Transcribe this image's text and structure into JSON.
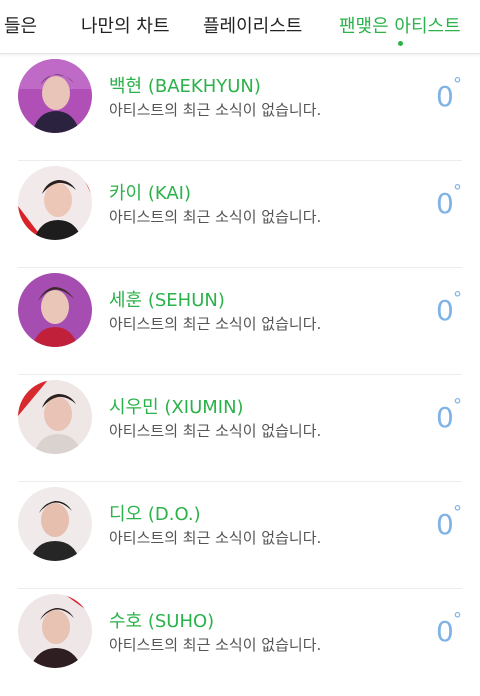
{
  "tabs": [
    {
      "label": "들은"
    },
    {
      "label": "나만의 차트"
    },
    {
      "label": "플레이리스트"
    },
    {
      "label": "팬맺은 아티스트"
    }
  ],
  "colors": {
    "accent": "#2cb24a",
    "temperature": "#7fb3e6"
  },
  "artists": [
    {
      "name": "백현 (BAEKHYUN)",
      "status": "아티스트의 최근 소식이 없습니다.",
      "temp_value": "0",
      "temp_unit": "°"
    },
    {
      "name": "카이 (KAI)",
      "status": "아티스트의 최근 소식이 없습니다.",
      "temp_value": "0",
      "temp_unit": "°"
    },
    {
      "name": "세훈 (SEHUN)",
      "status": "아티스트의 최근 소식이 없습니다.",
      "temp_value": "0",
      "temp_unit": "°"
    },
    {
      "name": "시우민 (XIUMIN)",
      "status": "아티스트의 최근 소식이 없습니다.",
      "temp_value": "0",
      "temp_unit": "°"
    },
    {
      "name": "디오 (D.O.)",
      "status": "아티스트의 최근 소식이 없습니다.",
      "temp_value": "0",
      "temp_unit": "°"
    },
    {
      "name": "수호 (SUHO)",
      "status": "아티스트의 최근 소식이 없습니다.",
      "temp_value": "0",
      "temp_unit": "°"
    }
  ]
}
